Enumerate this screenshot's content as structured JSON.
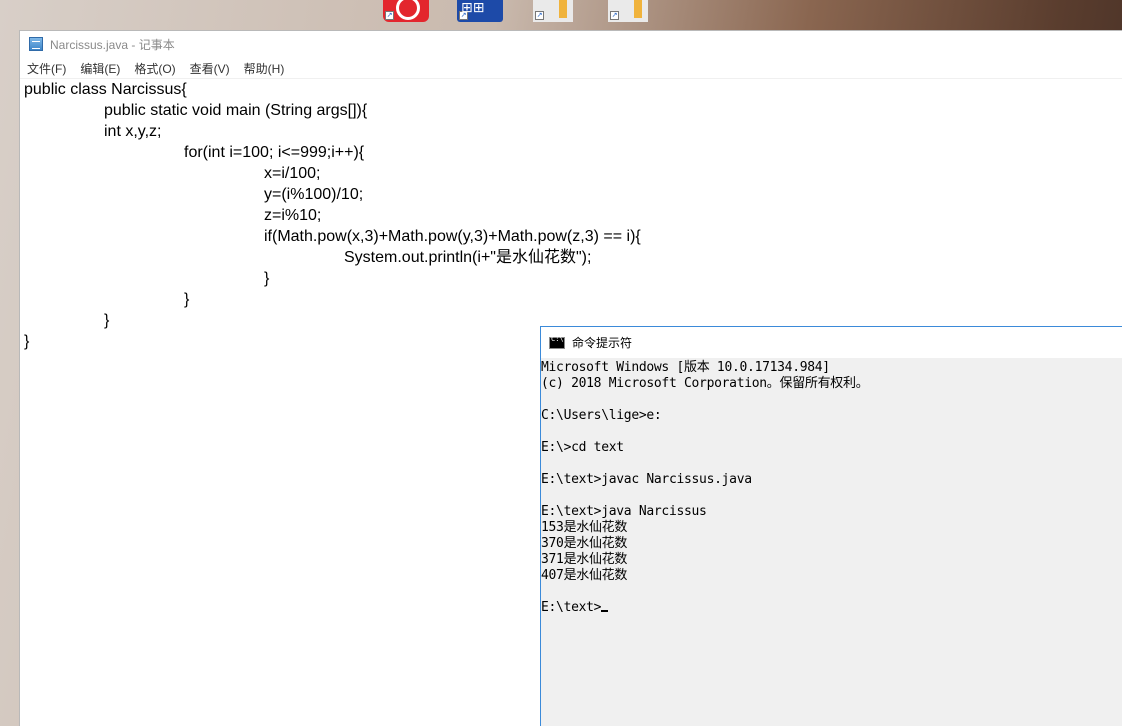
{
  "notepad": {
    "title": "Narcissus.java - 记事本",
    "menu": [
      "文件(F)",
      "编辑(E)",
      "格式(O)",
      "查看(V)",
      "帮助(H)"
    ],
    "lines": [
      {
        "indent": 0,
        "text": "public class Narcissus{"
      },
      {
        "indent": 1,
        "text": "public static void main (String args[]){"
      },
      {
        "indent": 1,
        "text": "int x,y,z;"
      },
      {
        "indent": 2,
        "text": "for(int i=100; i<=999;i++){"
      },
      {
        "indent": 3,
        "text": "x=i/100;"
      },
      {
        "indent": 3,
        "text": "y=(i%100)/10;"
      },
      {
        "indent": 3,
        "text": "z=i%10;"
      },
      {
        "indent": 3,
        "text": "if(Math.pow(x,3)+Math.pow(y,3)+Math.pow(z,3) == i){"
      },
      {
        "indent": 4,
        "text": "System.out.println(i+\"是水仙花数\");"
      },
      {
        "indent": 3,
        "text": "}"
      },
      {
        "indent": 2,
        "text": "}"
      },
      {
        "indent": 1,
        "text": "}"
      },
      {
        "indent": 0,
        "text": "}"
      }
    ]
  },
  "console": {
    "title": "命令提示符",
    "lines": [
      "Microsoft Windows [版本 10.0.17134.984]",
      "(c) 2018 Microsoft Corporation。保留所有权利。",
      "",
      "C:\\Users\\lige>e:",
      "",
      "E:\\>cd text",
      "",
      "E:\\text>javac Narcissus.java",
      "",
      "E:\\text>java Narcissus",
      "153是水仙花数",
      "370是水仙花数",
      "371是水仙花数",
      "407是水仙花数",
      "",
      "E:\\text>"
    ]
  },
  "colors": {
    "console_border": "#3b8ad9",
    "console_bg": "#f0f0f0"
  }
}
